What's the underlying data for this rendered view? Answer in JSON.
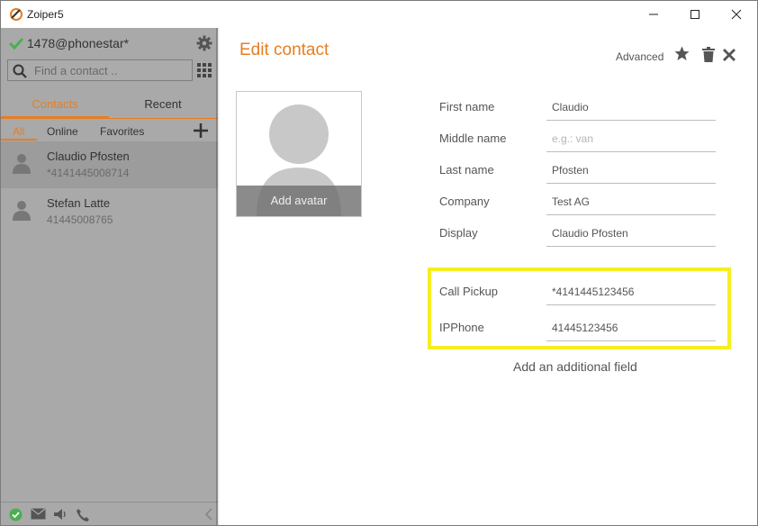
{
  "window": {
    "title": "Zoiper5",
    "colors": {
      "accent": "#e67e22",
      "sidebar": "#a9a9a9",
      "highlight": "#f6ee20",
      "online": "#4caf50"
    }
  },
  "account": {
    "name": "1478@phonestar*",
    "status_icon": "check-icon"
  },
  "search": {
    "placeholder": "Find a contact .."
  },
  "tabs": {
    "contacts": "Contacts",
    "recent": "Recent",
    "active": "contacts"
  },
  "subtabs": {
    "all": "All",
    "online": "Online",
    "favorites": "Favorites",
    "active": "all"
  },
  "contacts": [
    {
      "name": "Claudio Pfosten",
      "number": "*4141445008714",
      "selected": true
    },
    {
      "name": "Stefan Latte",
      "number": "41445008765",
      "selected": false
    }
  ],
  "editor": {
    "title": "Edit contact",
    "advanced": "Advanced",
    "avatar_caption": "Add avatar",
    "fields": [
      {
        "label": "First name",
        "value": "Claudio",
        "placeholder": ""
      },
      {
        "label": "Middle name",
        "value": "",
        "placeholder": "e.g.: van"
      },
      {
        "label": "Last name",
        "value": "Pfosten",
        "placeholder": ""
      },
      {
        "label": "Company",
        "value": "Test AG",
        "placeholder": ""
      },
      {
        "label": "Display",
        "value": "Claudio Pfosten",
        "placeholder": ""
      }
    ],
    "extra_fields": [
      {
        "label": "Call Pickup",
        "value": "*4141445123456"
      },
      {
        "label": "IPPhone",
        "value": "41445123456"
      }
    ],
    "add_field": "Add an additional field"
  }
}
